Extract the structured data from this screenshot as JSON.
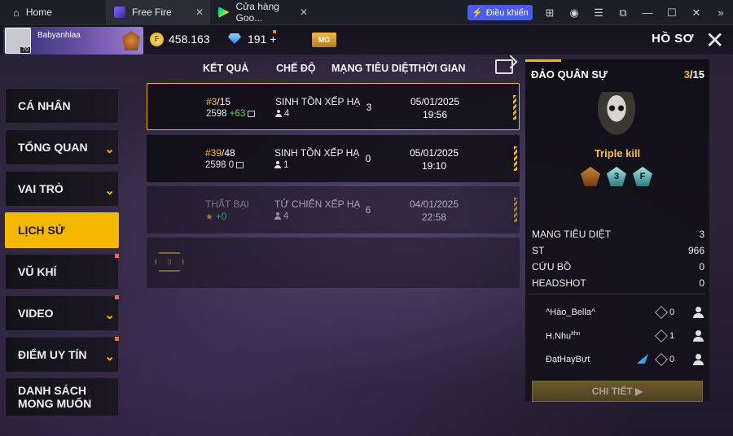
{
  "emulator": {
    "tabs": [
      {
        "label": "Home",
        "icon": "home-icon"
      },
      {
        "label": "Free Fire",
        "icon": "free-fire-icon"
      },
      {
        "label": "Cửa hàng Goo...",
        "icon": "play-store-icon"
      }
    ],
    "control_button": "Điều khiển",
    "window_icons": [
      "gamepad-icon",
      "account-icon",
      "menu-icon",
      "screenshot-icon",
      "minimize-icon",
      "maximize-icon",
      "close-icon",
      "expand-icon"
    ]
  },
  "topbar": {
    "player_name": "Babyanhlaa",
    "level": "70",
    "gold": "458.163",
    "diamonds": "191 +",
    "mg_label": "MG",
    "page_title": "HỒ SƠ"
  },
  "sidebar": {
    "items": [
      {
        "label": "CÁ NHÂN"
      },
      {
        "label": "TỔNG QUAN"
      },
      {
        "label": "VAI TRÒ"
      },
      {
        "label": "LỊCH SỬ"
      },
      {
        "label": "VŨ KHÍ"
      },
      {
        "label": "VIDEO"
      },
      {
        "label": "ĐIỂM UY TÍN"
      },
      {
        "label_line1": "DANH SÁCH",
        "label_line2": "MONG MUỐN"
      }
    ]
  },
  "history": {
    "columns": [
      "KẾT QUẢ",
      "CHẾ ĐỘ",
      "MẠNG TIÊU DIỆT",
      "THỜI GIAN"
    ],
    "rows": [
      {
        "rank": "#3",
        "total": "/15",
        "score": "2598",
        "delta": "+63",
        "mode": "SINH TỒN XẾP HẠ",
        "team": "4",
        "kills": "3",
        "date": "05/01/2025",
        "time": "19:56"
      },
      {
        "rank": "#39",
        "total": "/48",
        "score": "2598",
        "delta": "0",
        "mode": "SINH TỒN XẾP HẠ",
        "team": "1",
        "kills": "0",
        "date": "05/01/2025",
        "time": "19:10"
      },
      {
        "rank": "THẤT BẠI",
        "total": "",
        "score": "",
        "delta": "+0",
        "mode": "TỬ CHIẾN XẾP HẠ",
        "team": "4",
        "kills": "6",
        "date": "04/01/2025",
        "time": "22:58"
      }
    ],
    "empty_badge": "3"
  },
  "detail": {
    "map_name": "ĐẢO QUÂN SỰ",
    "count_hl": "3",
    "count_total": "/15",
    "achievement": "Triple kill",
    "badges": [
      "",
      "3",
      "F"
    ],
    "stats": [
      {
        "label": "MẠNG TIÊU DIỆT",
        "value": "3"
      },
      {
        "label": "ST",
        "value": "966"
      },
      {
        "label": "CỨU BỒ",
        "value": "0"
      },
      {
        "label": "HEADSHOT",
        "value": "0"
      }
    ],
    "teammates": [
      {
        "name": "^Hào_Bella^",
        "kills": "0"
      },
      {
        "name": "H.Nhu",
        "sup": "lthn",
        "kills": "1"
      },
      {
        "name": "ĐạtHayBựt",
        "sup": "",
        "kills": "0"
      }
    ],
    "detail_button": "CHI TIẾT ▶"
  }
}
